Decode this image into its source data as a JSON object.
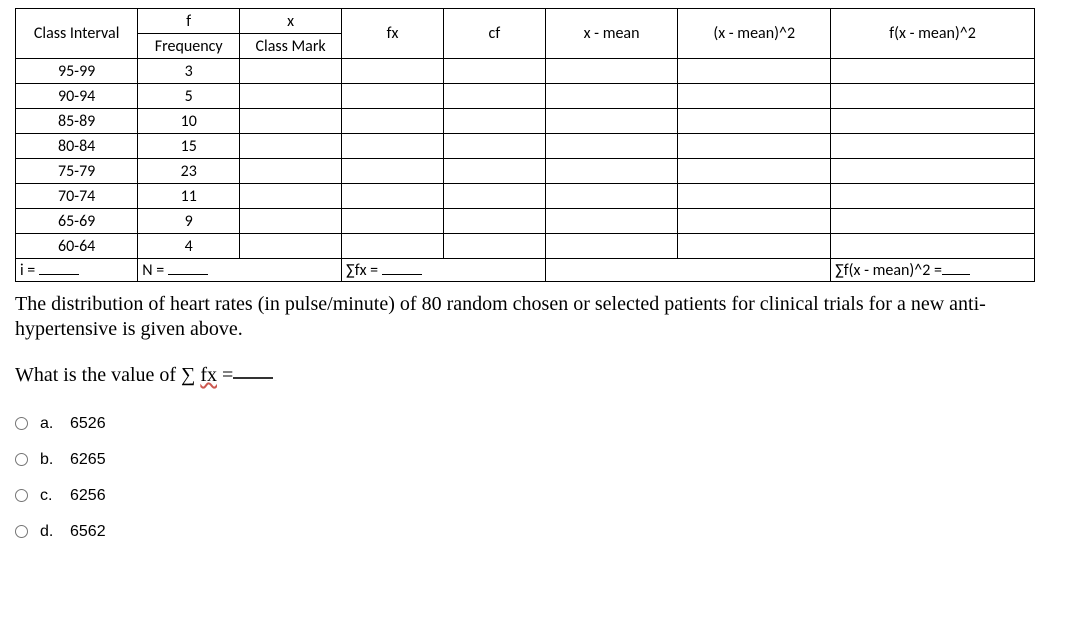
{
  "table": {
    "header_top": [
      "Class Interval",
      "f",
      "x",
      "fx",
      "cf",
      "x - mean",
      "(x - mean)^2",
      "f(x - mean)^2"
    ],
    "header_sub": [
      "",
      "Frequency",
      "Class Mark",
      "",
      "",
      "",
      "",
      ""
    ],
    "rows": [
      [
        "95-99",
        "3",
        "",
        "",
        "",
        "",
        "",
        ""
      ],
      [
        "90-94",
        "5",
        "",
        "",
        "",
        "",
        "",
        ""
      ],
      [
        "85-89",
        "10",
        "",
        "",
        "",
        "",
        "",
        ""
      ],
      [
        "80-84",
        "15",
        "",
        "",
        "",
        "",
        "",
        ""
      ],
      [
        "75-79",
        "23",
        "",
        "",
        "",
        "",
        "",
        ""
      ],
      [
        "70-74",
        "11",
        "",
        "",
        "",
        "",
        "",
        ""
      ],
      [
        "65-69",
        "9",
        "",
        "",
        "",
        "",
        "",
        ""
      ],
      [
        "60-64",
        "4",
        "",
        "",
        "",
        "",
        "",
        ""
      ]
    ],
    "summary": {
      "i_label": "i =",
      "n_label": "N =",
      "sumfx_label": "∑fx =",
      "sumfxm2_label": "∑f(x - mean)^2 ="
    }
  },
  "body_text": "The distribution of heart rates (in pulse/minute) of 80 random chosen or selected patients for clinical trials for a new anti-hypertensive is given above.",
  "question_prefix": "What is the value of ∑ ",
  "question_fx": "fx",
  "question_eq": " =",
  "options": [
    {
      "letter": "a.",
      "value": "6526"
    },
    {
      "letter": "b.",
      "value": "6265"
    },
    {
      "letter": "c.",
      "value": "6256"
    },
    {
      "letter": "d.",
      "value": "6562"
    }
  ]
}
